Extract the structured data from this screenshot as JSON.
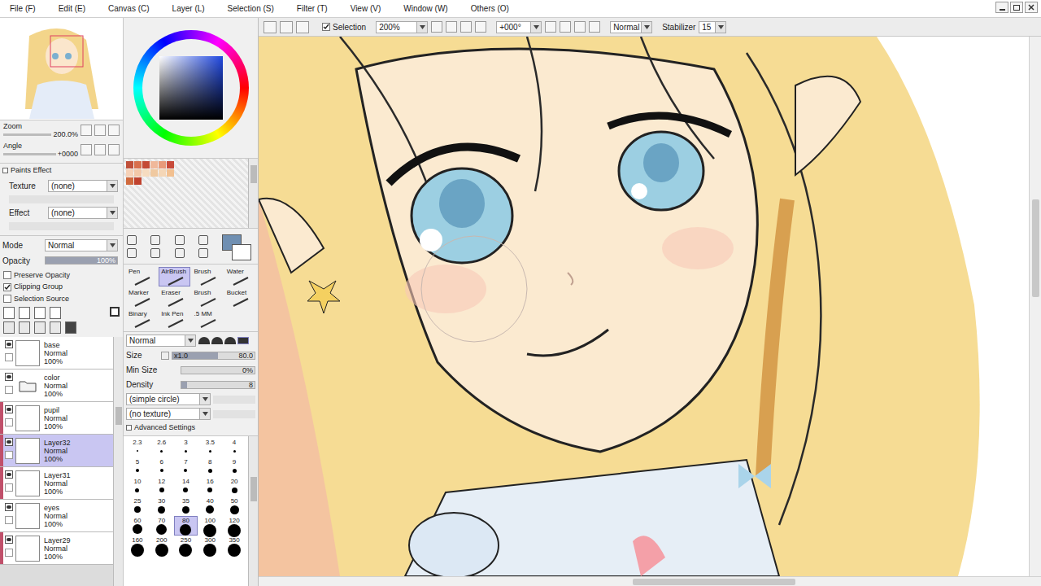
{
  "menu": [
    "File (F)",
    "Edit (E)",
    "Canvas (C)",
    "Layer (L)",
    "Selection (S)",
    "Filter (T)",
    "View (V)",
    "Window (W)",
    "Others (O)"
  ],
  "toolbar": {
    "selection": {
      "label": "Selection",
      "checked": true
    },
    "zoom": "200%",
    "angle": "+000°",
    "mode": "Normal",
    "stabilizer": {
      "label": "Stabilizer",
      "value": "15"
    }
  },
  "navigator": {
    "zoom": {
      "label": "Zoom",
      "value": "200.0%"
    },
    "angle": {
      "label": "Angle",
      "value": "+0000"
    }
  },
  "paints_effect": {
    "title": "Paints Effect",
    "texture": {
      "label": "Texture",
      "value": "(none)"
    },
    "effect": {
      "label": "Effect",
      "value": "(none)"
    }
  },
  "layer_props": {
    "mode": {
      "label": "Mode",
      "value": "Normal"
    },
    "opacity": {
      "label": "Opacity",
      "value": "100%",
      "level": 1
    }
  },
  "options": [
    {
      "label": "Preserve Opacity",
      "checked": false
    },
    {
      "label": "Clipping Group",
      "checked": true
    },
    {
      "label": "Selection Source",
      "checked": false
    }
  ],
  "layers": [
    {
      "name": "base",
      "mode": "Normal",
      "opacity": "100%",
      "kind": "layer",
      "visible": true,
      "selected": false,
      "clipped": false
    },
    {
      "name": "color",
      "mode": "Normal",
      "opacity": "100%",
      "kind": "folder",
      "visible": true,
      "selected": false,
      "clipped": false
    },
    {
      "name": "pupil",
      "mode": "Normal",
      "opacity": "100%",
      "kind": "layer",
      "visible": true,
      "selected": false,
      "clipped": true
    },
    {
      "name": "Layer32",
      "mode": "Normal",
      "opacity": "100%",
      "kind": "layer",
      "visible": true,
      "selected": true,
      "clipped": true
    },
    {
      "name": "Layer31",
      "mode": "Normal",
      "opacity": "100%",
      "kind": "layer",
      "visible": true,
      "selected": false,
      "clipped": true
    },
    {
      "name": "eyes",
      "mode": "Normal",
      "opacity": "100%",
      "kind": "layer",
      "visible": true,
      "selected": false,
      "clipped": false
    },
    {
      "name": "Layer29",
      "mode": "Normal",
      "opacity": "100%",
      "kind": "layer",
      "visible": true,
      "selected": false,
      "clipped": true
    }
  ],
  "current_color": "#6f8fb2",
  "swatches": [
    {
      "color": "#c0503a"
    },
    {
      "color": "#d8704e"
    },
    {
      "color": "#c44a36"
    },
    {
      "color": "#f0b89a"
    },
    {
      "color": "#e89a7a"
    },
    {
      "color": "#c84a3a"
    },
    {
      "color": "#f6d2b8"
    },
    {
      "color": "#f3c8a8"
    },
    {
      "color": "#f6dcc0"
    },
    {
      "color": "#f0c9a0"
    },
    {
      "color": "#f4d6b6"
    },
    {
      "color": "#f2c090"
    },
    {
      "color": "#d06a3e"
    },
    {
      "color": "#c0422e"
    }
  ],
  "tools": [
    {
      "label": "Pen",
      "selected": false
    },
    {
      "label": "AirBrush",
      "selected": true
    },
    {
      "label": "Brush",
      "selected": false
    },
    {
      "label": "Water",
      "selected": false
    },
    {
      "label": "Marker",
      "selected": false
    },
    {
      "label": "Eraser",
      "selected": false
    },
    {
      "label": "Brush",
      "selected": false
    },
    {
      "label": "Bucket",
      "selected": false
    },
    {
      "label": "Binary",
      "selected": false
    },
    {
      "label": "Ink Pen",
      "selected": false
    },
    {
      "label": ".5 MM",
      "selected": false
    }
  ],
  "brush": {
    "blend": "Normal",
    "size": {
      "label": "Size",
      "multiplier": "x1.0",
      "value": "80.0",
      "level": 0.55
    },
    "min_size": {
      "label": "Min Size",
      "value": "0%",
      "level": 0
    },
    "density": {
      "label": "Density",
      "value": "8",
      "level": 0.08
    },
    "shape": "(simple circle)",
    "texture": "(no texture)",
    "advanced": "Advanced Settings"
  },
  "sizes": [
    {
      "label": "2.3",
      "selected": false
    },
    {
      "label": "2.6",
      "selected": false
    },
    {
      "label": "3",
      "selected": false
    },
    {
      "label": "3.5",
      "selected": false
    },
    {
      "label": "4",
      "selected": false
    },
    {
      "label": "5",
      "selected": false
    },
    {
      "label": "6",
      "selected": false
    },
    {
      "label": "7",
      "selected": false
    },
    {
      "label": "8",
      "selected": false
    },
    {
      "label": "9",
      "selected": false
    },
    {
      "label": "10",
      "selected": false
    },
    {
      "label": "12",
      "selected": false
    },
    {
      "label": "14",
      "selected": false
    },
    {
      "label": "16",
      "selected": false
    },
    {
      "label": "20",
      "selected": false
    },
    {
      "label": "25",
      "selected": false
    },
    {
      "label": "30",
      "selected": false
    },
    {
      "label": "35",
      "selected": false
    },
    {
      "label": "40",
      "selected": false
    },
    {
      "label": "50",
      "selected": false
    },
    {
      "label": "60",
      "selected": false
    },
    {
      "label": "70",
      "selected": false
    },
    {
      "label": "80",
      "selected": true
    },
    {
      "label": "100",
      "selected": false
    },
    {
      "label": "120",
      "selected": false
    },
    {
      "label": "160",
      "selected": false
    },
    {
      "label": "200",
      "selected": false
    },
    {
      "label": "250",
      "selected": false
    },
    {
      "label": "300",
      "selected": false
    },
    {
      "label": "350",
      "selected": false
    }
  ]
}
